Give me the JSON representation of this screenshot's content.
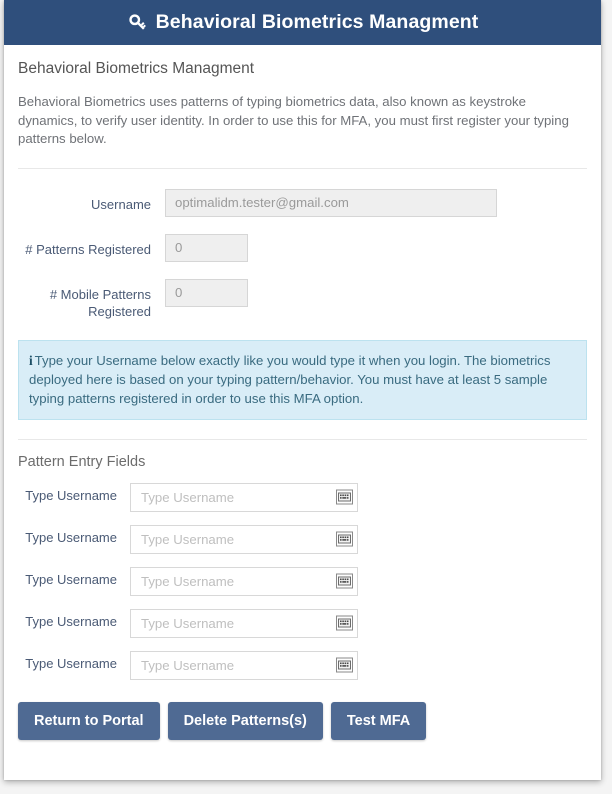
{
  "header": {
    "icon": "key-icon",
    "title": "Behavioral Biometrics Managment"
  },
  "main": {
    "section_title": "Behavioral Biometrics Managment",
    "intro": "Behavioral Biometrics uses patterns of typing biometrics data, also known as keystroke dynamics, to verify user identity. In order to use this for MFA, you must first register your typing patterns below."
  },
  "info_fields": [
    {
      "label": "Username",
      "value": "optimalidm.tester@gmail.com",
      "size": "wide"
    },
    {
      "label": "# Patterns Registered",
      "value": "0",
      "size": "narrow"
    },
    {
      "label": "# Mobile Patterns Registered",
      "value": "0",
      "size": "narrow"
    }
  ],
  "alert": {
    "icon": "info-icon",
    "icon_glyph": "i",
    "text": "Type your Username below exactly like you would type it when you login. The biometrics deployed here is based on your typing pattern/behavior. You must have at least 5 sample typing patterns registered in order to use this MFA option.",
    "background": "#d9edf7"
  },
  "pattern_section": {
    "heading": "Pattern Entry Fields",
    "rows": [
      {
        "label": "Type Username",
        "value": "",
        "placeholder": "Type Username",
        "button_icon": "keyboard-icon"
      },
      {
        "label": "Type Username",
        "value": "",
        "placeholder": "Type Username",
        "button_icon": "keyboard-icon"
      },
      {
        "label": "Type Username",
        "value": "",
        "placeholder": "Type Username",
        "button_icon": "keyboard-icon"
      },
      {
        "label": "Type Username",
        "value": "",
        "placeholder": "Type Username",
        "button_icon": "keyboard-icon"
      },
      {
        "label": "Type Username",
        "value": "",
        "placeholder": "Type Username",
        "button_icon": "keyboard-icon"
      }
    ]
  },
  "buttons": [
    {
      "label": "Return to Portal",
      "name": "return-to-portal-button"
    },
    {
      "label": "Delete Patterns(s)",
      "name": "delete-patterns-button"
    },
    {
      "label": "Test MFA",
      "name": "test-mfa-button"
    }
  ],
  "colors": {
    "header_bg": "#2f4f7c",
    "button_bg": "#4f6a93",
    "alert_bg": "#d9edf7",
    "label_text": "#4a5a75"
  }
}
